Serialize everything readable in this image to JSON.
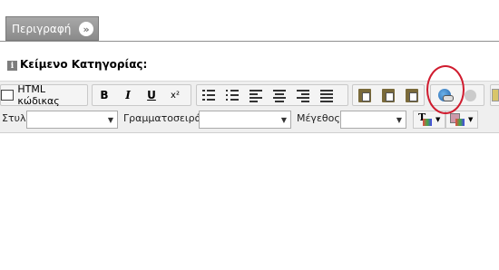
{
  "panel": {
    "tab_label": "Περιγραφή",
    "tab_icon": "chevron-double-down-icon"
  },
  "section": {
    "title": "Κείμενο Κατηγορίας:",
    "icon": "info-icon"
  },
  "toolbar": {
    "source_label": "HTML κώδικας",
    "bold": "B",
    "italic": "I",
    "underline": "U",
    "superscript": "x²"
  },
  "format_row": {
    "style_label": "Στυλ",
    "style_value": "",
    "font_label": "Γραμματοσειρά",
    "font_value": "",
    "size_label": "Μέγεθος",
    "size_value": "",
    "text_color_glyph": "T"
  },
  "highlight": {
    "color": "#d01c2f",
    "target": "insert-link-button"
  }
}
